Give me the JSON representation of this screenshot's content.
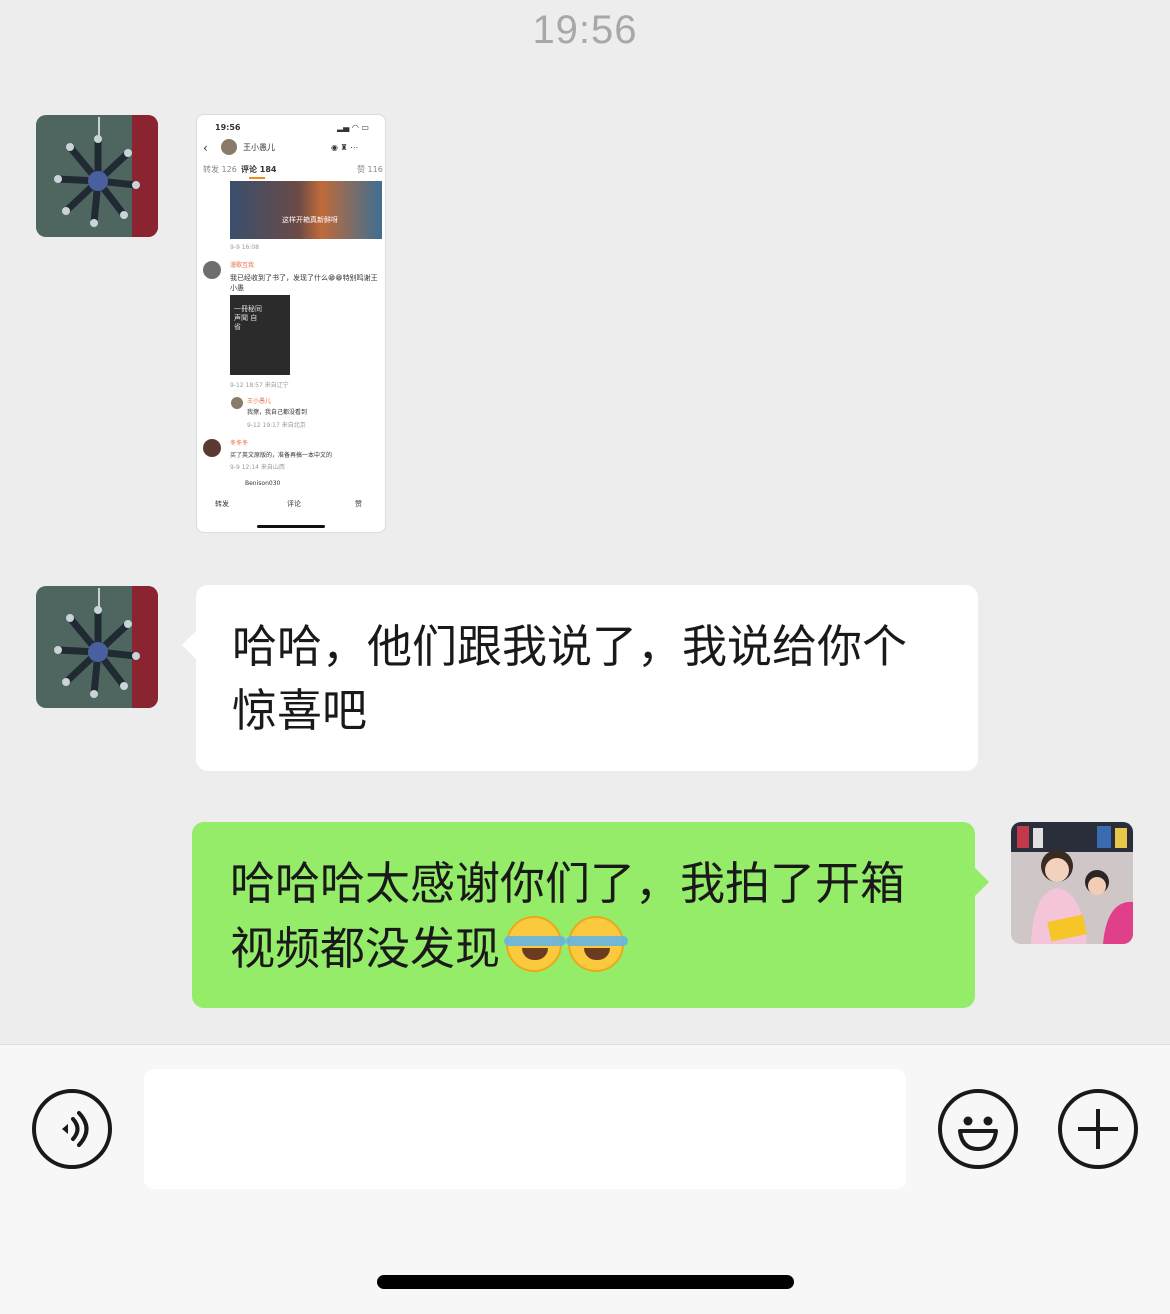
{
  "header": {
    "time": "19:56"
  },
  "messages": [
    {
      "type": "image",
      "sender": "friend",
      "screenshot": {
        "status_time": "19:56",
        "user_name": "王小愚儿",
        "tabs": [
          "转发 126",
          "评论 184",
          "赞 116"
        ],
        "video_caption": "这样开箱真新鲜呀",
        "first_post_time": "9-9 16:08",
        "comments": [
          {
            "name": "漫歌互我",
            "text": "我已经收到了书了，发现了什么😁😁特别鸣谢王小愚",
            "time": "9-12 18:57 来自辽宁"
          },
          {
            "name": "王小愚儿",
            "text": "我擦，我自己都没看到",
            "time": "9-12 19:17 来自北京"
          },
          {
            "name": "冬冬冬",
            "text": "买了英文原版的，准备再搞一本中文的",
            "time": "9-9 12:14 来自山西"
          },
          {
            "name": "Benison030",
            "text": "",
            "time": ""
          }
        ],
        "book_text": "一冊秘同 声聞 自省",
        "actions": [
          "转发",
          "评论",
          "赞"
        ]
      }
    },
    {
      "type": "text",
      "sender": "friend",
      "text": "哈哈，他们跟我说了，我说给你个惊喜吧"
    },
    {
      "type": "text",
      "sender": "self",
      "text": "哈哈哈太感谢你们了，我拍了开箱视频都没发现"
    }
  ],
  "icons": {
    "voice": "voice-icon",
    "emoji": "emoji-icon",
    "more": "plus-icon",
    "reaction": "laughing-crying-emoji"
  },
  "colors": {
    "background": "#ededed",
    "self_bubble": "#95ec69",
    "friend_bubble": "#ffffff",
    "toolbar": "#f7f7f7"
  }
}
